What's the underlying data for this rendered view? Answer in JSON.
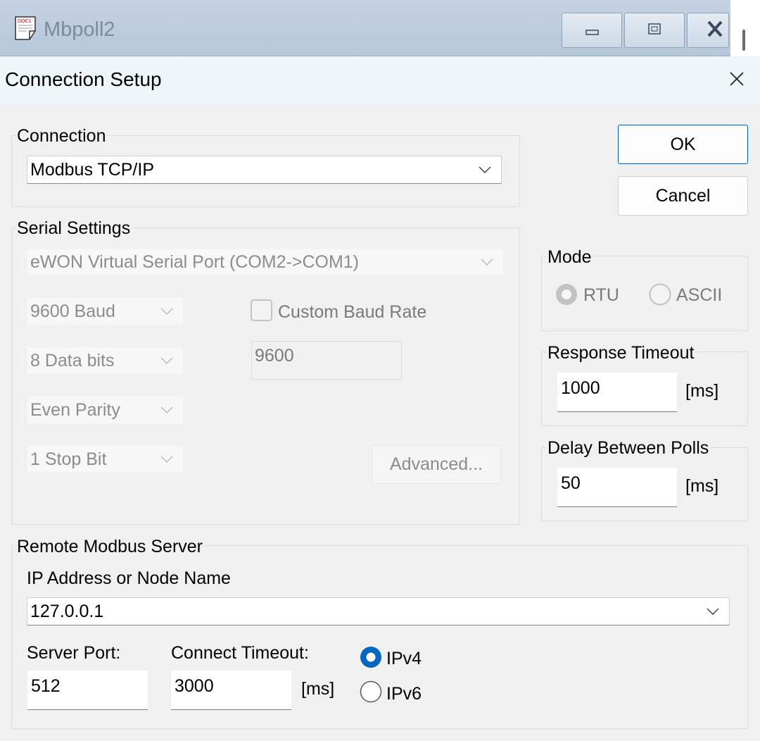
{
  "background_window": {
    "title": "Mbpoll2",
    "icon_caption": "DOC1"
  },
  "dialog": {
    "title": "Connection Setup"
  },
  "connection": {
    "label": "Connection",
    "selected": "Modbus TCP/IP"
  },
  "buttons": {
    "ok": "OK",
    "cancel": "Cancel",
    "advanced": "Advanced..."
  },
  "serial": {
    "label": "Serial Settings",
    "port": "eWON Virtual Serial Port (COM2->COM1)",
    "baud": "9600 Baud",
    "data_bits": "8 Data bits",
    "parity": "Even Parity",
    "stop_bits": "1 Stop Bit",
    "custom_baud_label": "Custom Baud Rate",
    "custom_baud_checked": false,
    "custom_baud_value": "9600"
  },
  "mode": {
    "label": "Mode",
    "options": [
      "RTU",
      "ASCII"
    ],
    "selected": "RTU",
    "enabled": false
  },
  "response_timeout": {
    "label": "Response Timeout",
    "value": "1000",
    "unit": "[ms]"
  },
  "delay_between_polls": {
    "label": "Delay Between Polls",
    "value": "50",
    "unit": "[ms]"
  },
  "remote": {
    "label": "Remote Modbus Server",
    "ip_label": "IP Address or Node Name",
    "ip_value": "127.0.0.1",
    "port_label": "Server Port:",
    "port_value": "512",
    "connect_timeout_label": "Connect Timeout:",
    "connect_timeout_value": "3000",
    "connect_timeout_unit": "[ms]",
    "ip_versions": [
      "IPv4",
      "IPv6"
    ],
    "ip_version_selected": "IPv4"
  },
  "colors": {
    "accent": "#0067c0",
    "dialog_titlebar": "#eef6f9",
    "dialog_bg": "#f0f0f0"
  }
}
